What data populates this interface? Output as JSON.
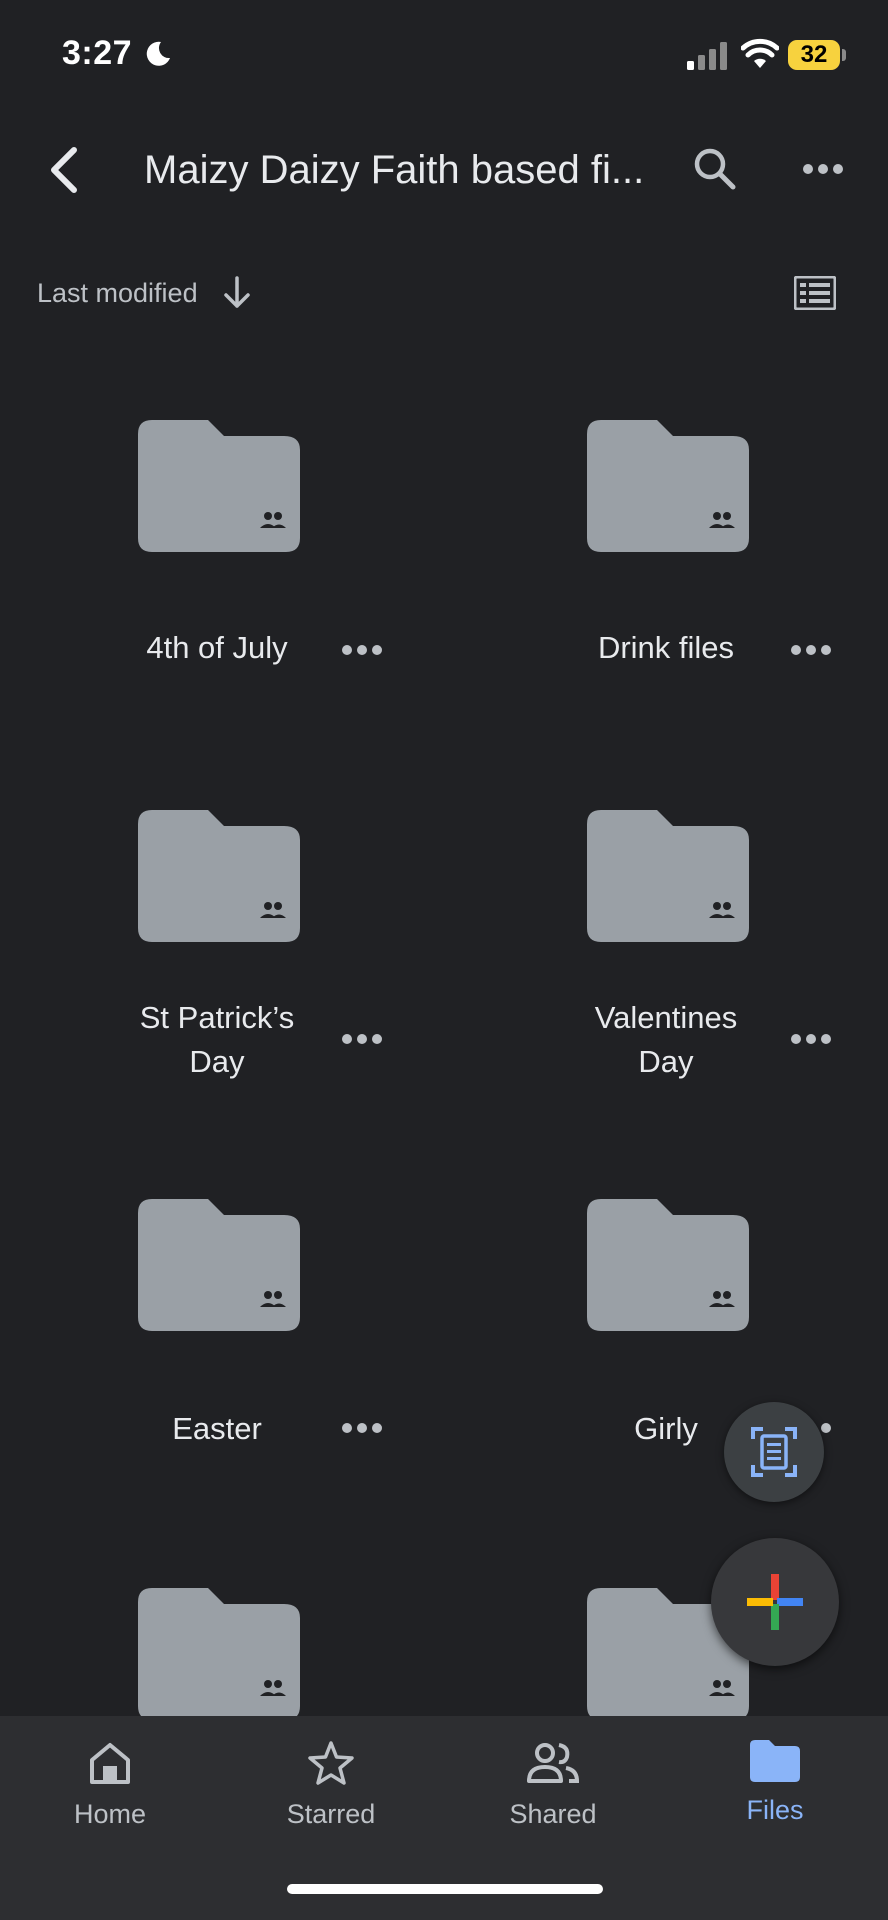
{
  "status_bar": {
    "time": "3:27",
    "battery": "32"
  },
  "header": {
    "title": "Maizy Daizy Faith based fi..."
  },
  "sort": {
    "label": "Last modified"
  },
  "folders": [
    {
      "name": "4th of July"
    },
    {
      "name": "Drink files"
    },
    {
      "name": "St Patrick’s Day"
    },
    {
      "name": "Valentines Day"
    },
    {
      "name": "Easter"
    },
    {
      "name": "Girly"
    },
    {
      "name": ""
    },
    {
      "name": ""
    }
  ],
  "nav": {
    "home": "Home",
    "starred": "Starred",
    "shared": "Shared",
    "files": "Files"
  },
  "colors": {
    "background": "#202124",
    "folder": "#9aa0a6",
    "accent": "#8ab4f8",
    "battery": "#f7d23e"
  }
}
